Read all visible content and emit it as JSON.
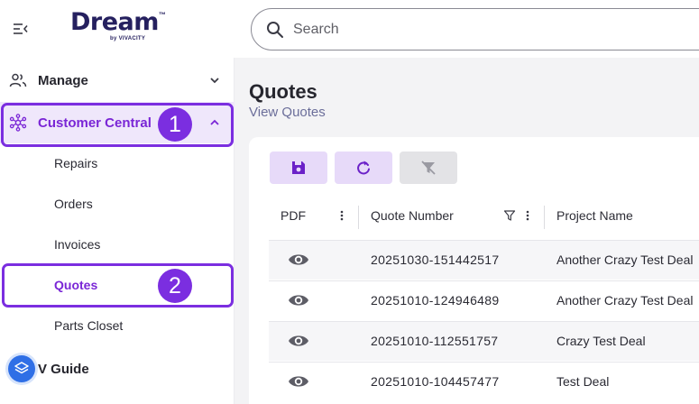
{
  "brand": {
    "name": "Dream",
    "tm": "™",
    "sub": "by VIVACITY"
  },
  "search": {
    "placeholder": "Search",
    "value": ""
  },
  "sidebar": {
    "manage": {
      "label": "Manage",
      "icon": "users-icon"
    },
    "customer_central": {
      "label": "Customer Central",
      "icon": "hub-icon",
      "expanded": true,
      "items": [
        {
          "label": "Repairs",
          "active": false
        },
        {
          "label": "Orders",
          "active": false
        },
        {
          "label": "Invoices",
          "active": false
        },
        {
          "label": "Quotes",
          "active": true
        },
        {
          "label": "Parts Closet",
          "active": false
        }
      ]
    },
    "vguide": {
      "label": "V Guide",
      "icon": "layers-icon"
    }
  },
  "callouts": {
    "one": "1",
    "two": "2"
  },
  "page": {
    "title": "Quotes",
    "subtitle": "View Quotes"
  },
  "toolbar": {
    "save_icon": "save-icon",
    "refresh_icon": "refresh-icon",
    "clear_filter_icon": "clear-filter-icon"
  },
  "table": {
    "columns": [
      "PDF",
      "Quote Number",
      "Project Name"
    ],
    "rows": [
      {
        "quote_number": "20251030-151442517",
        "project_name": "Another Crazy Test Deal"
      },
      {
        "quote_number": "20251010-124946489",
        "project_name": "Another Crazy Test Deal"
      },
      {
        "quote_number": "20251010-112551757",
        "project_name": "Crazy Test Deal"
      },
      {
        "quote_number": "20251010-104457477",
        "project_name": "Test Deal"
      }
    ]
  },
  "colors": {
    "accent": "#7b2ee0",
    "active_text": "#7a26d6",
    "active_bg": "#efe7fb",
    "brand_navy": "#25205f",
    "vguide_blue": "#2f6fe6"
  }
}
